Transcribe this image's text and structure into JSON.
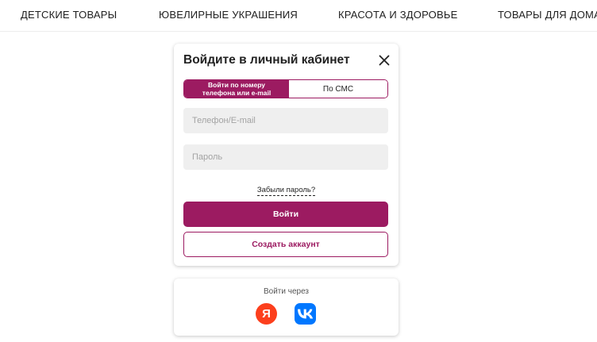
{
  "nav": {
    "items": [
      {
        "label": "ДЕТСКИЕ ТОВАРЫ"
      },
      {
        "label": "ЮВЕЛИРНЫЕ УКРАШЕНИЯ"
      },
      {
        "label": "КРАСОТА И ЗДОРОВЬЕ"
      },
      {
        "label": "ТОВАРЫ ДЛЯ ДОМА"
      }
    ]
  },
  "login": {
    "title": "Войдите в личный кабинет",
    "tabs": [
      {
        "line1": "Войти по номеру",
        "line2": "телефона или e-mail",
        "active": true
      },
      {
        "label": "По СМС",
        "active": false
      }
    ],
    "phone_placeholder": "Телефон/E-mail",
    "phone_value": "",
    "password_placeholder": "Пароль",
    "password_value": "",
    "forgot_label": "Забыли пароль?",
    "submit_label": "Войти",
    "register_label": "Создать аккаунт"
  },
  "social": {
    "title": "Войти через",
    "yandex_letter": "Я",
    "icons": [
      "yandex-icon",
      "vk-icon"
    ]
  },
  "colors": {
    "accent": "#9c1b61",
    "yandex": "#fc3f1d",
    "vk": "#0077ff",
    "field_bg": "#efefef"
  }
}
